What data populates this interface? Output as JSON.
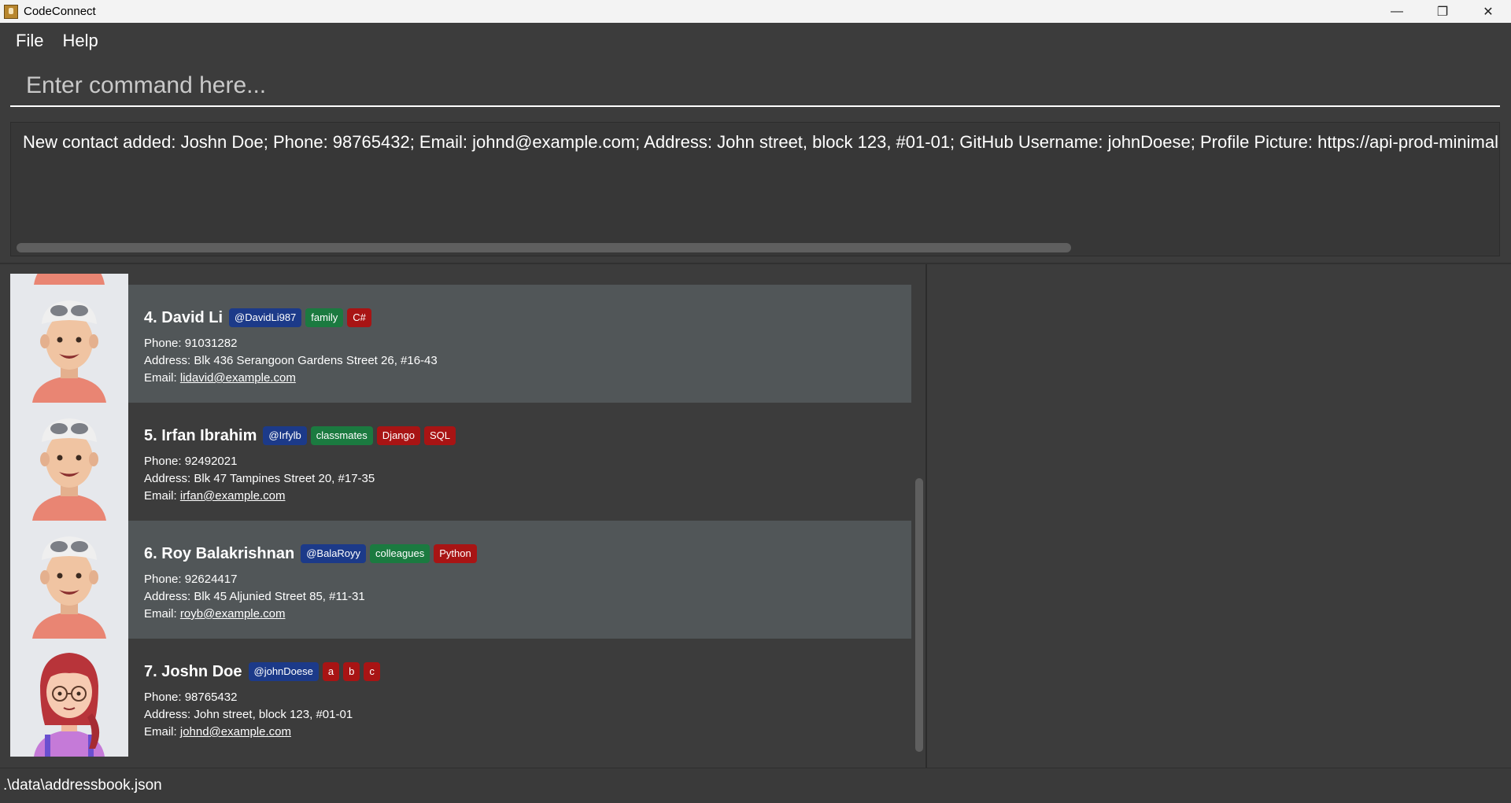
{
  "window": {
    "title": "CodeConnect",
    "controls": {
      "minimize": "—",
      "restore": "❐",
      "close": "✕"
    },
    "icon": "app-icon"
  },
  "menu": {
    "file": "File",
    "help": "Help"
  },
  "command": {
    "placeholder": "Enter command here...",
    "value": ""
  },
  "result": {
    "text": "New contact added: Joshn Doe; Phone: 98765432; Email: johnd@example.com; Address: John street, block 123, #01-01; GitHub Username: johnDoese; Profile Picture: https://api-prod-minimal-v"
  },
  "contacts": [
    {
      "index": "4.",
      "name": "David Li",
      "github": "@DavidLi987",
      "tags": [
        {
          "label": "family",
          "color": "green"
        },
        {
          "label": "C#",
          "color": "red"
        }
      ],
      "phone": "Phone: 91031282",
      "address": "Address: Blk 436 Serangoon Gardens Street 26, #16-43",
      "email_label": "Email:",
      "email": "lidavid@example.com",
      "avatar": "avatar-boy-cap"
    },
    {
      "index": "5.",
      "name": "Irfan Ibrahim",
      "github": "@Irfylb",
      "tags": [
        {
          "label": "classmates",
          "color": "green"
        },
        {
          "label": "Django",
          "color": "red"
        },
        {
          "label": "SQL",
          "color": "red"
        }
      ],
      "phone": "Phone: 92492021",
      "address": "Address: Blk 47 Tampines Street 20, #17-35",
      "email_label": "Email:",
      "email": "irfan@example.com",
      "avatar": "avatar-boy-cap"
    },
    {
      "index": "6.",
      "name": "Roy Balakrishnan",
      "github": "@BalaRoyy",
      "tags": [
        {
          "label": "colleagues",
          "color": "green"
        },
        {
          "label": "Python",
          "color": "red"
        }
      ],
      "phone": "Phone: 92624417",
      "address": "Address: Blk 45 Aljunied Street 85, #11-31",
      "email_label": "Email:",
      "email": "royb@example.com",
      "avatar": "avatar-boy-cap"
    },
    {
      "index": "7.",
      "name": "Joshn Doe",
      "github": "@johnDoese",
      "tags": [
        {
          "label": "a",
          "color": "red"
        },
        {
          "label": "b",
          "color": "red"
        },
        {
          "label": "c",
          "color": "red"
        }
      ],
      "phone": "Phone: 98765432",
      "address": "Address: John street, block 123, #01-01",
      "email_label": "Email:",
      "email": "johnd@example.com",
      "avatar": "avatar-girl-glasses"
    }
  ],
  "status": {
    "path": ".\\data\\addressbook.json"
  },
  "colors": {
    "background": "#3c3c3c",
    "card_highlight": "#515658",
    "tag_github": "#1c3a89",
    "tag_green": "#1b7a40",
    "tag_red": "#a81414"
  }
}
